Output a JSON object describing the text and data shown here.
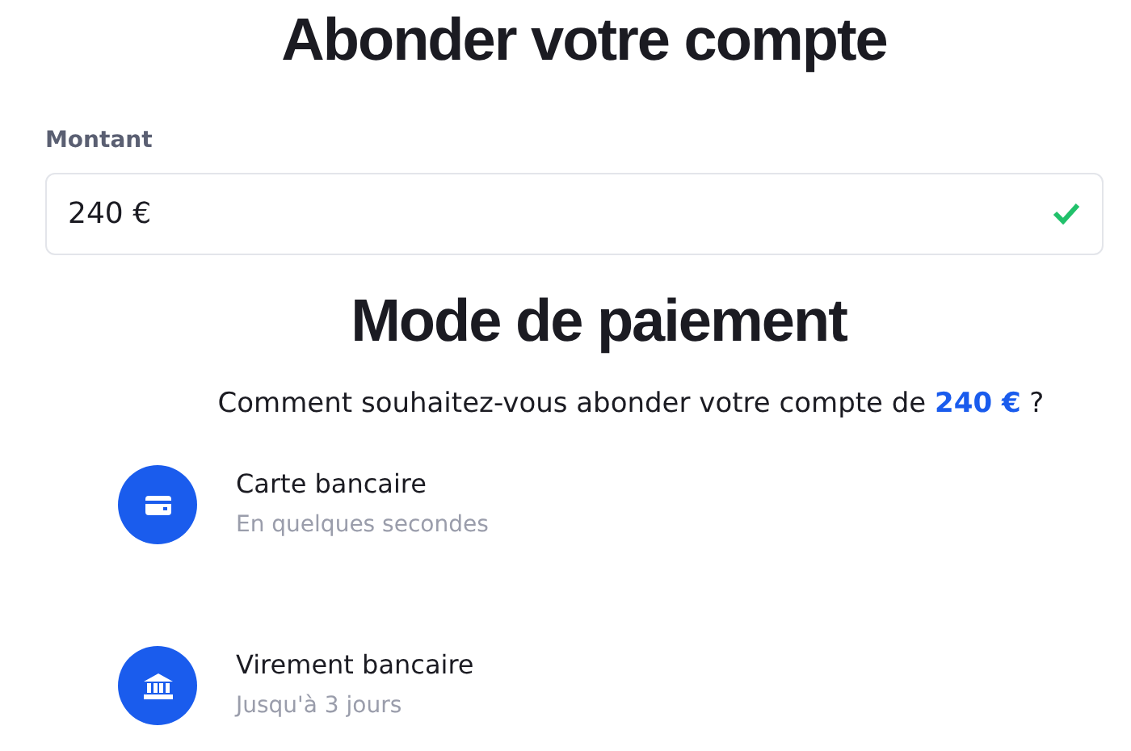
{
  "title": "Abonder votre compte",
  "amount": {
    "label": "Montant",
    "value": "240 €",
    "valid": true
  },
  "payment": {
    "heading": "Mode de paiement",
    "question": "Comment souhaitez-vous abonder votre compte de **240 €** ?",
    "methods": [
      {
        "kind": "card",
        "name": "Carte bancaire",
        "delay": "En quelques secondes"
      },
      {
        "kind": "bank",
        "name": "Virement bancaire",
        "delay": "Jusqu'à 3 jours"
      }
    ]
  }
}
